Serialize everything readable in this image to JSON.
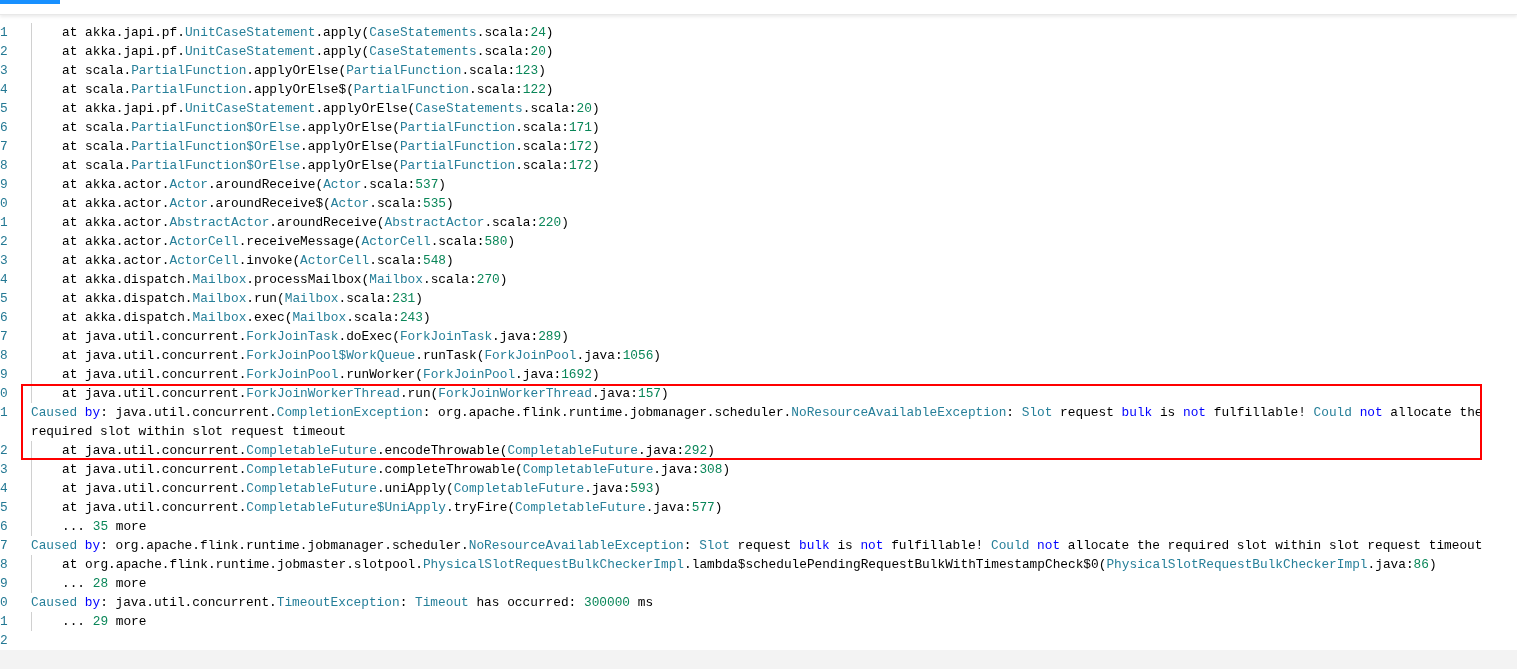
{
  "tabs": [
    {
      "selected": true
    }
  ],
  "lines": [
    {
      "number": "1",
      "indent": true,
      "boxed": false,
      "tokens": [
        {
          "kind": "plain",
          "text": "at akka.japi.pf."
        },
        {
          "kind": "type",
          "text": "UnitCaseStatement"
        },
        {
          "kind": "plain",
          "text": ".apply("
        },
        {
          "kind": "type",
          "text": "CaseStatements"
        },
        {
          "kind": "plain",
          "text": ".scala:"
        },
        {
          "kind": "number",
          "text": "24"
        },
        {
          "kind": "plain",
          "text": ")"
        }
      ]
    },
    {
      "number": "2",
      "indent": true,
      "boxed": false,
      "tokens": [
        {
          "kind": "plain",
          "text": "at akka.japi.pf."
        },
        {
          "kind": "type",
          "text": "UnitCaseStatement"
        },
        {
          "kind": "plain",
          "text": ".apply("
        },
        {
          "kind": "type",
          "text": "CaseStatements"
        },
        {
          "kind": "plain",
          "text": ".scala:"
        },
        {
          "kind": "number",
          "text": "20"
        },
        {
          "kind": "plain",
          "text": ")"
        }
      ]
    },
    {
      "number": "3",
      "indent": true,
      "boxed": false,
      "tokens": [
        {
          "kind": "plain",
          "text": "at scala."
        },
        {
          "kind": "type",
          "text": "PartialFunction"
        },
        {
          "kind": "plain",
          "text": ".applyOrElse("
        },
        {
          "kind": "type",
          "text": "PartialFunction"
        },
        {
          "kind": "plain",
          "text": ".scala:"
        },
        {
          "kind": "number",
          "text": "123"
        },
        {
          "kind": "plain",
          "text": ")"
        }
      ]
    },
    {
      "number": "4",
      "indent": true,
      "boxed": false,
      "tokens": [
        {
          "kind": "plain",
          "text": "at scala."
        },
        {
          "kind": "type",
          "text": "PartialFunction"
        },
        {
          "kind": "plain",
          "text": ".applyOrElse$("
        },
        {
          "kind": "type",
          "text": "PartialFunction"
        },
        {
          "kind": "plain",
          "text": ".scala:"
        },
        {
          "kind": "number",
          "text": "122"
        },
        {
          "kind": "plain",
          "text": ")"
        }
      ]
    },
    {
      "number": "5",
      "indent": true,
      "boxed": false,
      "tokens": [
        {
          "kind": "plain",
          "text": "at akka.japi.pf."
        },
        {
          "kind": "type",
          "text": "UnitCaseStatement"
        },
        {
          "kind": "plain",
          "text": ".applyOrElse("
        },
        {
          "kind": "type",
          "text": "CaseStatements"
        },
        {
          "kind": "plain",
          "text": ".scala:"
        },
        {
          "kind": "number",
          "text": "20"
        },
        {
          "kind": "plain",
          "text": ")"
        }
      ]
    },
    {
      "number": "6",
      "indent": true,
      "boxed": false,
      "tokens": [
        {
          "kind": "plain",
          "text": "at scala."
        },
        {
          "kind": "type",
          "text": "PartialFunction$OrElse"
        },
        {
          "kind": "plain",
          "text": ".applyOrElse("
        },
        {
          "kind": "type",
          "text": "PartialFunction"
        },
        {
          "kind": "plain",
          "text": ".scala:"
        },
        {
          "kind": "number",
          "text": "171"
        },
        {
          "kind": "plain",
          "text": ")"
        }
      ]
    },
    {
      "number": "7",
      "indent": true,
      "boxed": false,
      "tokens": [
        {
          "kind": "plain",
          "text": "at scala."
        },
        {
          "kind": "type",
          "text": "PartialFunction$OrElse"
        },
        {
          "kind": "plain",
          "text": ".applyOrElse("
        },
        {
          "kind": "type",
          "text": "PartialFunction"
        },
        {
          "kind": "plain",
          "text": ".scala:"
        },
        {
          "kind": "number",
          "text": "172"
        },
        {
          "kind": "plain",
          "text": ")"
        }
      ]
    },
    {
      "number": "8",
      "indent": true,
      "boxed": false,
      "tokens": [
        {
          "kind": "plain",
          "text": "at scala."
        },
        {
          "kind": "type",
          "text": "PartialFunction$OrElse"
        },
        {
          "kind": "plain",
          "text": ".applyOrElse("
        },
        {
          "kind": "type",
          "text": "PartialFunction"
        },
        {
          "kind": "plain",
          "text": ".scala:"
        },
        {
          "kind": "number",
          "text": "172"
        },
        {
          "kind": "plain",
          "text": ")"
        }
      ]
    },
    {
      "number": "9",
      "indent": true,
      "boxed": false,
      "tokens": [
        {
          "kind": "plain",
          "text": "at akka.actor."
        },
        {
          "kind": "type",
          "text": "Actor"
        },
        {
          "kind": "plain",
          "text": ".aroundReceive("
        },
        {
          "kind": "type",
          "text": "Actor"
        },
        {
          "kind": "plain",
          "text": ".scala:"
        },
        {
          "kind": "number",
          "text": "537"
        },
        {
          "kind": "plain",
          "text": ")"
        }
      ]
    },
    {
      "number": "0",
      "indent": true,
      "boxed": false,
      "tokens": [
        {
          "kind": "plain",
          "text": "at akka.actor."
        },
        {
          "kind": "type",
          "text": "Actor"
        },
        {
          "kind": "plain",
          "text": ".aroundReceive$("
        },
        {
          "kind": "type",
          "text": "Actor"
        },
        {
          "kind": "plain",
          "text": ".scala:"
        },
        {
          "kind": "number",
          "text": "535"
        },
        {
          "kind": "plain",
          "text": ")"
        }
      ]
    },
    {
      "number": "1",
      "indent": true,
      "boxed": false,
      "tokens": [
        {
          "kind": "plain",
          "text": "at akka.actor."
        },
        {
          "kind": "type",
          "text": "AbstractActor"
        },
        {
          "kind": "plain",
          "text": ".aroundReceive("
        },
        {
          "kind": "type",
          "text": "AbstractActor"
        },
        {
          "kind": "plain",
          "text": ".scala:"
        },
        {
          "kind": "number",
          "text": "220"
        },
        {
          "kind": "plain",
          "text": ")"
        }
      ]
    },
    {
      "number": "2",
      "indent": true,
      "boxed": false,
      "tokens": [
        {
          "kind": "plain",
          "text": "at akka.actor."
        },
        {
          "kind": "type",
          "text": "ActorCell"
        },
        {
          "kind": "plain",
          "text": ".receiveMessage("
        },
        {
          "kind": "type",
          "text": "ActorCell"
        },
        {
          "kind": "plain",
          "text": ".scala:"
        },
        {
          "kind": "number",
          "text": "580"
        },
        {
          "kind": "plain",
          "text": ")"
        }
      ]
    },
    {
      "number": "3",
      "indent": true,
      "boxed": false,
      "tokens": [
        {
          "kind": "plain",
          "text": "at akka.actor."
        },
        {
          "kind": "type",
          "text": "ActorCell"
        },
        {
          "kind": "plain",
          "text": ".invoke("
        },
        {
          "kind": "type",
          "text": "ActorCell"
        },
        {
          "kind": "plain",
          "text": ".scala:"
        },
        {
          "kind": "number",
          "text": "548"
        },
        {
          "kind": "plain",
          "text": ")"
        }
      ]
    },
    {
      "number": "4",
      "indent": true,
      "boxed": false,
      "tokens": [
        {
          "kind": "plain",
          "text": "at akka.dispatch."
        },
        {
          "kind": "type",
          "text": "Mailbox"
        },
        {
          "kind": "plain",
          "text": ".processMailbox("
        },
        {
          "kind": "type",
          "text": "Mailbox"
        },
        {
          "kind": "plain",
          "text": ".scala:"
        },
        {
          "kind": "number",
          "text": "270"
        },
        {
          "kind": "plain",
          "text": ")"
        }
      ]
    },
    {
      "number": "5",
      "indent": true,
      "boxed": false,
      "tokens": [
        {
          "kind": "plain",
          "text": "at akka.dispatch."
        },
        {
          "kind": "type",
          "text": "Mailbox"
        },
        {
          "kind": "plain",
          "text": ".run("
        },
        {
          "kind": "type",
          "text": "Mailbox"
        },
        {
          "kind": "plain",
          "text": ".scala:"
        },
        {
          "kind": "number",
          "text": "231"
        },
        {
          "kind": "plain",
          "text": ")"
        }
      ]
    },
    {
      "number": "6",
      "indent": true,
      "boxed": false,
      "tokens": [
        {
          "kind": "plain",
          "text": "at akka.dispatch."
        },
        {
          "kind": "type",
          "text": "Mailbox"
        },
        {
          "kind": "plain",
          "text": ".exec("
        },
        {
          "kind": "type",
          "text": "Mailbox"
        },
        {
          "kind": "plain",
          "text": ".scala:"
        },
        {
          "kind": "number",
          "text": "243"
        },
        {
          "kind": "plain",
          "text": ")"
        }
      ]
    },
    {
      "number": "7",
      "indent": true,
      "boxed": false,
      "tokens": [
        {
          "kind": "plain",
          "text": "at java.util.concurrent."
        },
        {
          "kind": "type",
          "text": "ForkJoinTask"
        },
        {
          "kind": "plain",
          "text": ".doExec("
        },
        {
          "kind": "type",
          "text": "ForkJoinTask"
        },
        {
          "kind": "plain",
          "text": ".java:"
        },
        {
          "kind": "number",
          "text": "289"
        },
        {
          "kind": "plain",
          "text": ")"
        }
      ]
    },
    {
      "number": "8",
      "indent": true,
      "boxed": false,
      "tokens": [
        {
          "kind": "plain",
          "text": "at java.util.concurrent."
        },
        {
          "kind": "type",
          "text": "ForkJoinPool$WorkQueue"
        },
        {
          "kind": "plain",
          "text": ".runTask("
        },
        {
          "kind": "type",
          "text": "ForkJoinPool"
        },
        {
          "kind": "plain",
          "text": ".java:"
        },
        {
          "kind": "number",
          "text": "1056"
        },
        {
          "kind": "plain",
          "text": ")"
        }
      ]
    },
    {
      "number": "9",
      "indent": true,
      "boxed": false,
      "tokens": [
        {
          "kind": "plain",
          "text": "at java.util.concurrent."
        },
        {
          "kind": "type",
          "text": "ForkJoinPool"
        },
        {
          "kind": "plain",
          "text": ".runWorker("
        },
        {
          "kind": "type",
          "text": "ForkJoinPool"
        },
        {
          "kind": "plain",
          "text": ".java:"
        },
        {
          "kind": "number",
          "text": "1692"
        },
        {
          "kind": "plain",
          "text": ")"
        }
      ]
    },
    {
      "number": "0",
      "indent": true,
      "boxed": true,
      "tokens": [
        {
          "kind": "plain",
          "text": "at java.util.concurrent."
        },
        {
          "kind": "type",
          "text": "ForkJoinWorkerThread"
        },
        {
          "kind": "plain",
          "text": ".run("
        },
        {
          "kind": "type",
          "text": "ForkJoinWorkerThread"
        },
        {
          "kind": "plain",
          "text": ".java:"
        },
        {
          "kind": "number",
          "text": "157"
        },
        {
          "kind": "plain",
          "text": ")"
        }
      ]
    },
    {
      "number": "1",
      "indent": false,
      "boxed": true,
      "tokens": [
        {
          "kind": "type",
          "text": "Caused"
        },
        {
          "kind": "keyword",
          "text": " by"
        },
        {
          "kind": "plain",
          "text": ": java.util.concurrent."
        },
        {
          "kind": "type",
          "text": "CompletionException"
        },
        {
          "kind": "plain",
          "text": ": org.apache.flink.runtime.jobmanager.scheduler."
        },
        {
          "kind": "type",
          "text": "NoResourceAvailableException"
        },
        {
          "kind": "plain",
          "text": ": "
        },
        {
          "kind": "type",
          "text": "Slot"
        },
        {
          "kind": "plain",
          "text": " request "
        },
        {
          "kind": "keyword",
          "text": "bulk"
        },
        {
          "kind": "plain",
          "text": " is "
        },
        {
          "kind": "keyword",
          "text": "not"
        },
        {
          "kind": "plain",
          "text": " fulfillable! "
        },
        {
          "kind": "type",
          "text": "Could"
        },
        {
          "kind": "keyword",
          "text": " not"
        },
        {
          "kind": "plain",
          "text": " allocate the required slot within slot request timeout"
        }
      ]
    },
    {
      "number": "2",
      "indent": true,
      "boxed": true,
      "tokens": [
        {
          "kind": "plain",
          "text": "at java.util.concurrent."
        },
        {
          "kind": "type",
          "text": "CompletableFuture"
        },
        {
          "kind": "plain",
          "text": ".encodeThrowable("
        },
        {
          "kind": "type",
          "text": "CompletableFuture"
        },
        {
          "kind": "plain",
          "text": ".java:"
        },
        {
          "kind": "number",
          "text": "292"
        },
        {
          "kind": "plain",
          "text": ")"
        }
      ]
    },
    {
      "number": "3",
      "indent": true,
      "boxed": false,
      "tokens": [
        {
          "kind": "plain",
          "text": "at java.util.concurrent."
        },
        {
          "kind": "type",
          "text": "CompletableFuture"
        },
        {
          "kind": "plain",
          "text": ".completeThrowable("
        },
        {
          "kind": "type",
          "text": "CompletableFuture"
        },
        {
          "kind": "plain",
          "text": ".java:"
        },
        {
          "kind": "number",
          "text": "308"
        },
        {
          "kind": "plain",
          "text": ")"
        }
      ]
    },
    {
      "number": "4",
      "indent": true,
      "boxed": false,
      "tokens": [
        {
          "kind": "plain",
          "text": "at java.util.concurrent."
        },
        {
          "kind": "type",
          "text": "CompletableFuture"
        },
        {
          "kind": "plain",
          "text": ".uniApply("
        },
        {
          "kind": "type",
          "text": "CompletableFuture"
        },
        {
          "kind": "plain",
          "text": ".java:"
        },
        {
          "kind": "number",
          "text": "593"
        },
        {
          "kind": "plain",
          "text": ")"
        }
      ]
    },
    {
      "number": "5",
      "indent": true,
      "boxed": false,
      "tokens": [
        {
          "kind": "plain",
          "text": "at java.util.concurrent."
        },
        {
          "kind": "type",
          "text": "CompletableFuture$UniApply"
        },
        {
          "kind": "plain",
          "text": ".tryFire("
        },
        {
          "kind": "type",
          "text": "CompletableFuture"
        },
        {
          "kind": "plain",
          "text": ".java:"
        },
        {
          "kind": "number",
          "text": "577"
        },
        {
          "kind": "plain",
          "text": ")"
        }
      ]
    },
    {
      "number": "6",
      "indent": true,
      "boxed": false,
      "tokens": [
        {
          "kind": "plain",
          "text": "... "
        },
        {
          "kind": "number",
          "text": "35"
        },
        {
          "kind": "plain",
          "text": " more"
        }
      ]
    },
    {
      "number": "7",
      "indent": false,
      "boxed": false,
      "tokens": [
        {
          "kind": "type",
          "text": "Caused"
        },
        {
          "kind": "keyword",
          "text": " by"
        },
        {
          "kind": "plain",
          "text": ": org.apache.flink.runtime.jobmanager.scheduler."
        },
        {
          "kind": "type",
          "text": "NoResourceAvailableException"
        },
        {
          "kind": "plain",
          "text": ": "
        },
        {
          "kind": "type",
          "text": "Slot"
        },
        {
          "kind": "plain",
          "text": " request "
        },
        {
          "kind": "keyword",
          "text": "bulk"
        },
        {
          "kind": "plain",
          "text": " is "
        },
        {
          "kind": "keyword",
          "text": "not"
        },
        {
          "kind": "plain",
          "text": " fulfillable! "
        },
        {
          "kind": "type",
          "text": "Could"
        },
        {
          "kind": "keyword",
          "text": " not"
        },
        {
          "kind": "plain",
          "text": " allocate the required slot within slot request timeout"
        }
      ]
    },
    {
      "number": "8",
      "indent": true,
      "boxed": false,
      "tokens": [
        {
          "kind": "plain",
          "text": "at org.apache.flink.runtime.jobmaster.slotpool."
        },
        {
          "kind": "type",
          "text": "PhysicalSlotRequestBulkCheckerImpl"
        },
        {
          "kind": "plain",
          "text": ".lambda$schedulePendingRequestBulkWithTimestampCheck$0("
        },
        {
          "kind": "type",
          "text": "PhysicalSlotRequestBulkCheckerImpl"
        },
        {
          "kind": "plain",
          "text": ".java:"
        },
        {
          "kind": "number",
          "text": "86"
        },
        {
          "kind": "plain",
          "text": ")"
        }
      ]
    },
    {
      "number": "9",
      "indent": true,
      "boxed": false,
      "tokens": [
        {
          "kind": "plain",
          "text": "... "
        },
        {
          "kind": "number",
          "text": "28"
        },
        {
          "kind": "plain",
          "text": " more"
        }
      ]
    },
    {
      "number": "0",
      "indent": false,
      "boxed": false,
      "tokens": [
        {
          "kind": "type",
          "text": "Caused"
        },
        {
          "kind": "keyword",
          "text": " by"
        },
        {
          "kind": "plain",
          "text": ": java.util.concurrent."
        },
        {
          "kind": "type",
          "text": "TimeoutException"
        },
        {
          "kind": "plain",
          "text": ": "
        },
        {
          "kind": "type",
          "text": "Timeout"
        },
        {
          "kind": "plain",
          "text": " has occurred: "
        },
        {
          "kind": "number",
          "text": "300000"
        },
        {
          "kind": "plain",
          "text": " ms"
        }
      ]
    },
    {
      "number": "1",
      "indent": true,
      "boxed": false,
      "tokens": [
        {
          "kind": "plain",
          "text": "... "
        },
        {
          "kind": "number",
          "text": "29"
        },
        {
          "kind": "plain",
          "text": " more"
        }
      ]
    },
    {
      "number": "2"
    }
  ]
}
